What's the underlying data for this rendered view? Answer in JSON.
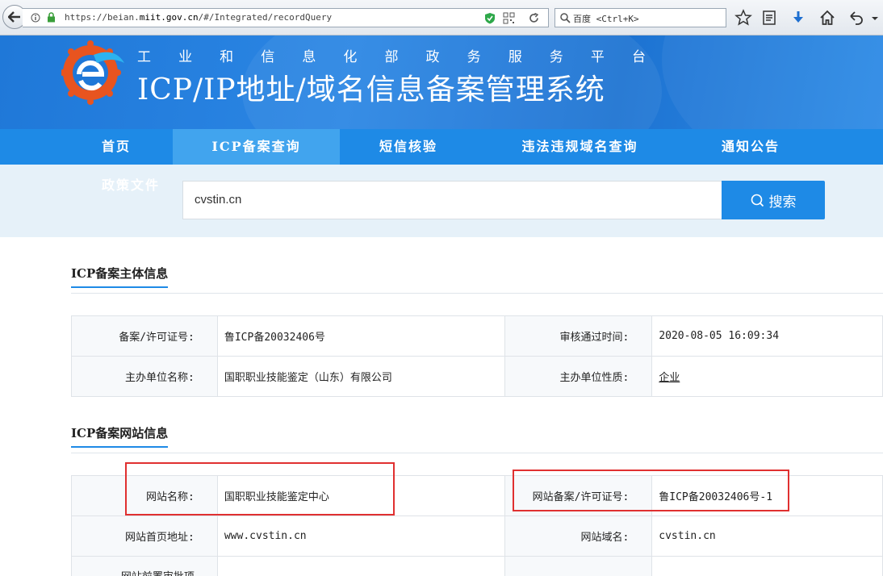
{
  "browser": {
    "url_prefix": "https://beian.",
    "url_domain": "miit.gov.cn",
    "url_suffix": "/#/Integrated/recordQuery",
    "search_placeholder": "百度 <Ctrl+K>"
  },
  "header": {
    "subtitle_chars": [
      "工",
      "业",
      "和",
      "信",
      "息",
      "化",
      "部",
      "政",
      "务",
      "服",
      "务",
      "平",
      "台"
    ],
    "title": "ICP/IP地址/域名信息备案管理系统"
  },
  "nav": {
    "items": [
      {
        "label": "首页"
      },
      {
        "label": "ICP备案查询"
      },
      {
        "label": "短信核验"
      },
      {
        "label": "违法违规域名查询"
      },
      {
        "label": "通知公告"
      }
    ],
    "policy": "政策文件"
  },
  "search": {
    "value": "cvstin.cn",
    "button_label": "搜索"
  },
  "subject_section": {
    "title": "ICP备案主体信息",
    "rows": [
      {
        "l1": "备案/许可证号:",
        "v1": "鲁ICP备20032406号",
        "l2": "审核通过时间:",
        "v2": "2020-08-05 16:09:34"
      },
      {
        "l1": "主办单位名称:",
        "v1": "国职职业技能鉴定（山东）有限公司",
        "l2": "主办单位性质:",
        "v2": "企业"
      }
    ]
  },
  "site_section": {
    "title": "ICP备案网站信息",
    "rows": [
      {
        "l1": "网站名称:",
        "v1": "国职职业技能鉴定中心",
        "l2": "网站备案/许可证号:",
        "v2": "鲁ICP备20032406号-1"
      },
      {
        "l1": "网站首页地址:",
        "v1": "www.cvstin.cn",
        "l2": "网站域名:",
        "v2": "cvstin.cn"
      },
      {
        "l1": "网站前置审批项",
        "v1": "",
        "l2": "",
        "v2": ""
      }
    ]
  },
  "colors": {
    "brand_blue": "#1e8ae6",
    "nav_active": "#41a4ee",
    "highlight_red": "#e03030"
  }
}
